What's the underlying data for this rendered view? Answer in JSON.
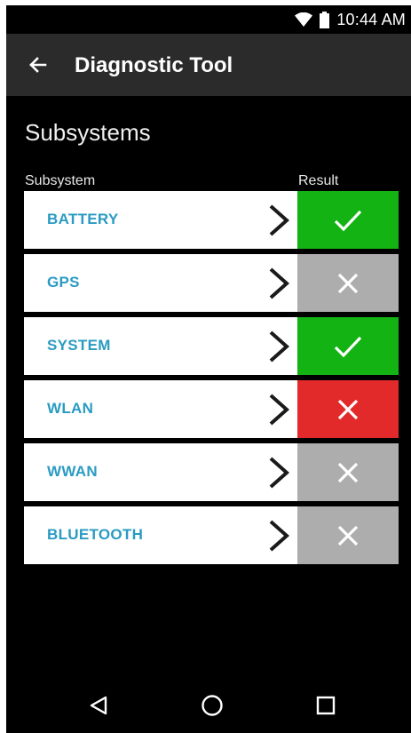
{
  "status_bar": {
    "time": "10:44 AM",
    "icons": [
      "wifi-icon",
      "battery-icon"
    ]
  },
  "app_bar": {
    "back_icon": "arrow-left-icon",
    "title": "Diagnostic Tool"
  },
  "section": {
    "title": "Subsystems",
    "col_subsystem": "Subsystem",
    "col_result": "Result"
  },
  "colors": {
    "pass": "#14b314",
    "fail": "#e22a2a",
    "not_run": "#adadad",
    "label": "#2a9bc2"
  },
  "rows": [
    {
      "label": "BATTERY",
      "result": "pass"
    },
    {
      "label": "GPS",
      "result": "not_run"
    },
    {
      "label": "SYSTEM",
      "result": "pass"
    },
    {
      "label": "WLAN",
      "result": "fail"
    },
    {
      "label": "WWAN",
      "result": "not_run"
    },
    {
      "label": "BLUETOOTH",
      "result": "not_run"
    }
  ],
  "nav_bar": {
    "icons": [
      "nav-back-icon",
      "nav-home-icon",
      "nav-recents-icon"
    ]
  }
}
